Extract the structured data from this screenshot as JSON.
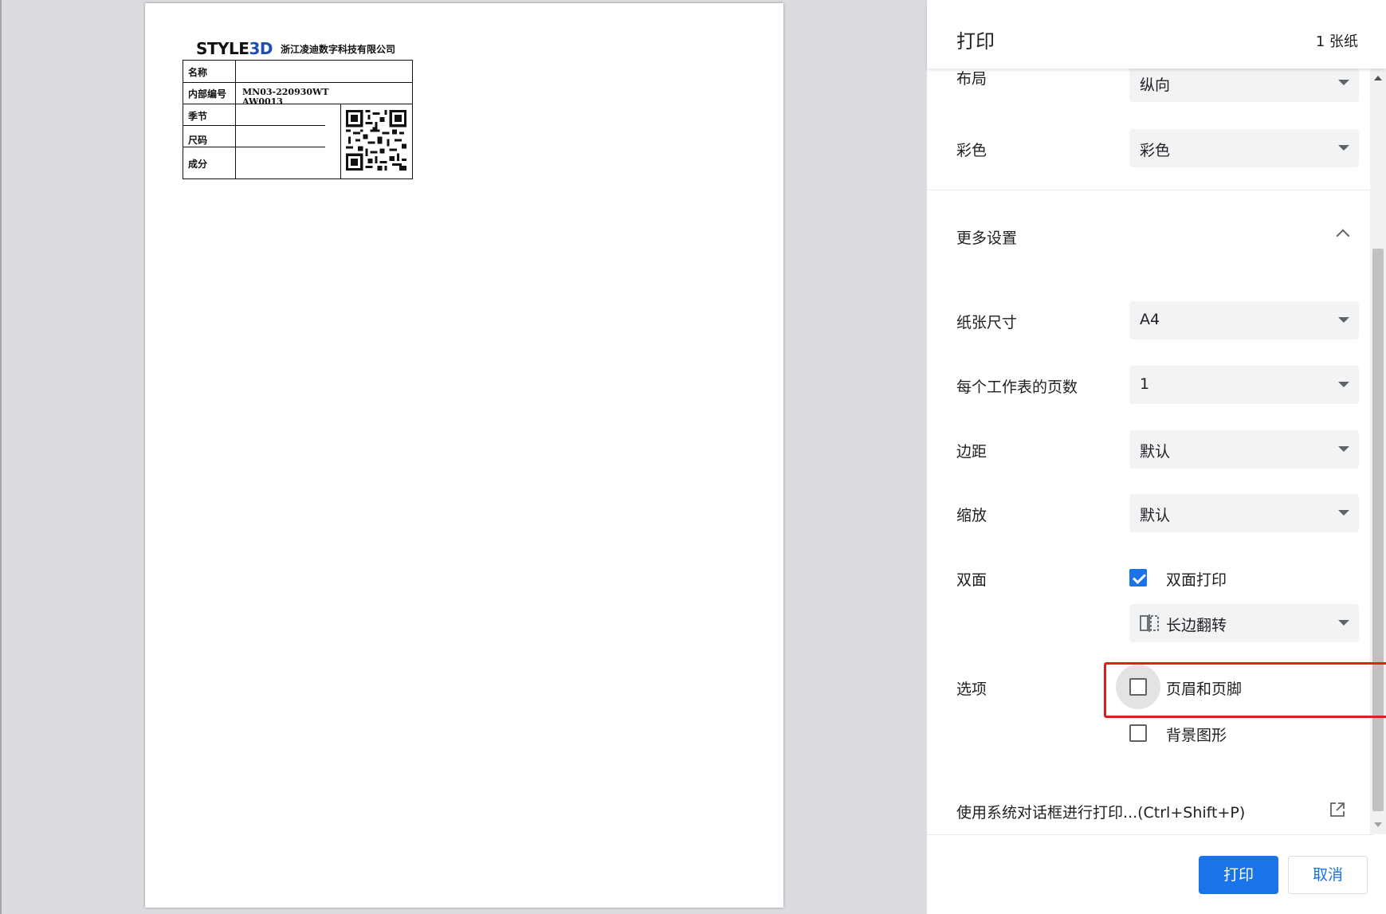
{
  "preview": {
    "logo": {
      "prefix": "STYLE",
      "accent": "3D",
      "accent_color": "#1f4fb5"
    },
    "company": "浙江凌迪数字科技有限公司",
    "label_rows": [
      {
        "key": "名称",
        "value": ""
      },
      {
        "key": "内部编号",
        "value": "MN03-220930WT AW0013"
      },
      {
        "key": "季节",
        "value": ""
      },
      {
        "key": "尺码",
        "value": ""
      },
      {
        "key": "成分",
        "value": ""
      }
    ],
    "qr_icon": "qr-code"
  },
  "header": {
    "title": "打印",
    "sheet_count": "1 张纸"
  },
  "settings": {
    "layout": {
      "label": "布局",
      "value": "纵向"
    },
    "color": {
      "label": "彩色",
      "value": "彩色"
    },
    "more_settings": "更多设置",
    "paper_size": {
      "label": "纸张尺寸",
      "value": "A4"
    },
    "pages_per_sheet": {
      "label": "每个工作表的页数",
      "value": "1"
    },
    "margins": {
      "label": "边距",
      "value": "默认"
    },
    "scale": {
      "label": "缩放",
      "value": "默认"
    },
    "duplex": {
      "label": "双面",
      "checkbox_label": "双面打印",
      "checked": true,
      "flip_value": "长边翻转"
    },
    "options": {
      "label": "选项",
      "headers_footers": {
        "label": "页眉和页脚",
        "checked": false
      },
      "background_graphics": {
        "label": "背景图形",
        "checked": false
      }
    },
    "system_dialog": "使用系统对话框进行打印...(Ctrl+Shift+P)"
  },
  "buttons": {
    "print": "打印",
    "cancel": "取消"
  },
  "colors": {
    "accent": "#1a73e8",
    "highlight": "#e0201a"
  }
}
